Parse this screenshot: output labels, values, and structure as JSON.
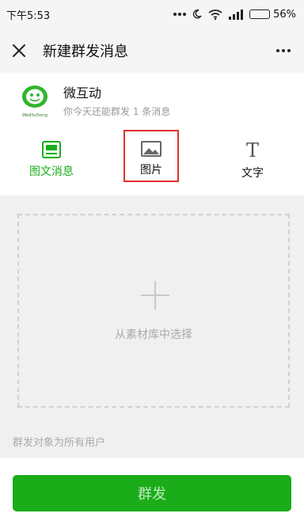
{
  "status_bar": {
    "time": "下午5:53",
    "battery_percent": "56%",
    "battery_level": 0.56
  },
  "header": {
    "title": "新建群发消息"
  },
  "account": {
    "name": "微互动",
    "quota": "你今天还能群发 1 条消息",
    "logo_text": "WeiHuDong"
  },
  "tabs": [
    {
      "label": "图文消息",
      "icon": "news-icon",
      "active": true
    },
    {
      "label": "图片",
      "icon": "image-icon",
      "active": false
    },
    {
      "label": "文字",
      "icon": "text-icon",
      "glyph": "T",
      "active": false
    }
  ],
  "upload": {
    "label": "从素材库中选择"
  },
  "target": {
    "label": "群发对象为所有用户"
  },
  "send_button": {
    "label": "群发"
  },
  "colors": {
    "accent": "#1aad19",
    "highlight_border": "#e0332e"
  }
}
